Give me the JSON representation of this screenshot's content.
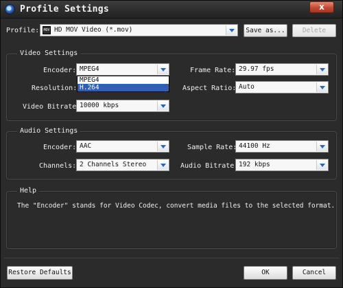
{
  "window": {
    "title": "Profile Settings",
    "close_label": "x"
  },
  "profile": {
    "label": "Profile:",
    "value": "HD MOV Video (*.mov)",
    "icon_text": "MOV",
    "save_as_label": "Save as...",
    "delete_label": "Delete"
  },
  "video": {
    "section_title": "Video Settings",
    "encoder_label": "Encoder:",
    "encoder_value": "MPEG4",
    "encoder_options": [
      "MPEG4",
      "H.264"
    ],
    "encoder_highlighted": "H.264",
    "resolution_label": "Resolution:",
    "bitrate_label": "Video Bitrate:",
    "bitrate_value": "10000 kbps",
    "framerate_label": "Frame Rate:",
    "framerate_value": "29.97 fps",
    "aspect_label": "Aspect Ratio:",
    "aspect_value": "Auto"
  },
  "audio": {
    "section_title": "Audio Settings",
    "encoder_label": "Encoder:",
    "encoder_value": "AAC",
    "channels_label": "Channels:",
    "channels_value": "2 Channels Stereo",
    "samplerate_label": "Sample Rate:",
    "samplerate_value": "44100 Hz",
    "bitrate_label": "Audio Bitrate:",
    "bitrate_value": "192 kbps"
  },
  "help": {
    "section_title": "Help",
    "text": "The \"Encoder\" stands for Video Codec, convert media files to the selected format."
  },
  "footer": {
    "restore_label": "Restore Defaults",
    "ok_label": "OK",
    "cancel_label": "Cancel"
  }
}
